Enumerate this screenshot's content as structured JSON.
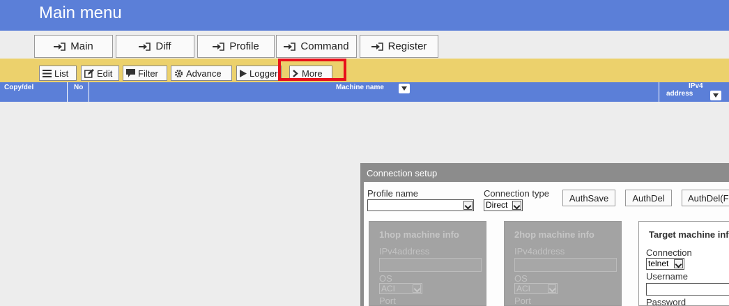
{
  "header": {
    "title": "Main menu"
  },
  "tabs": [
    {
      "label": "Main"
    },
    {
      "label": "Diff"
    },
    {
      "label": "Profile"
    },
    {
      "label": "Command"
    },
    {
      "label": "Register"
    }
  ],
  "toolbar": {
    "list": "List",
    "edit": "Edit",
    "filter": "Filter",
    "advance": "Advance",
    "logger": "Logger",
    "more": "More"
  },
  "table": {
    "col_copy": "Copy/del",
    "col_no": "No",
    "col_machine": "Machine name",
    "col_ipv4_line1": "IPv4",
    "col_ipv4_line2": "address"
  },
  "dialog": {
    "title": "Connection setup",
    "profile_label": "Profile name",
    "profile_value": "",
    "conn_type_label": "Connection type",
    "conn_type_value": "Direct",
    "auth_save": "AuthSave",
    "auth_del": "AuthDel",
    "auth_del_f": "AuthDel(F",
    "hop1": {
      "title": "1hop machine info",
      "ipv4": "IPv4address",
      "os": "OS",
      "os_value": "ACI",
      "port": "Port"
    },
    "hop2": {
      "title": "2hop machine info",
      "ipv4": "IPv4address",
      "os": "OS",
      "os_value": "ACI",
      "port": "Port"
    },
    "target": {
      "title": "Target machine inf",
      "connection": "Connection",
      "connection_value": "telnet",
      "username": "Username",
      "password": "Password"
    }
  },
  "colors": {
    "header": "#5b7fd8",
    "toolbar": "#ecd16c",
    "highlight": "#e8101a",
    "dialog": "#8c8c8c"
  }
}
